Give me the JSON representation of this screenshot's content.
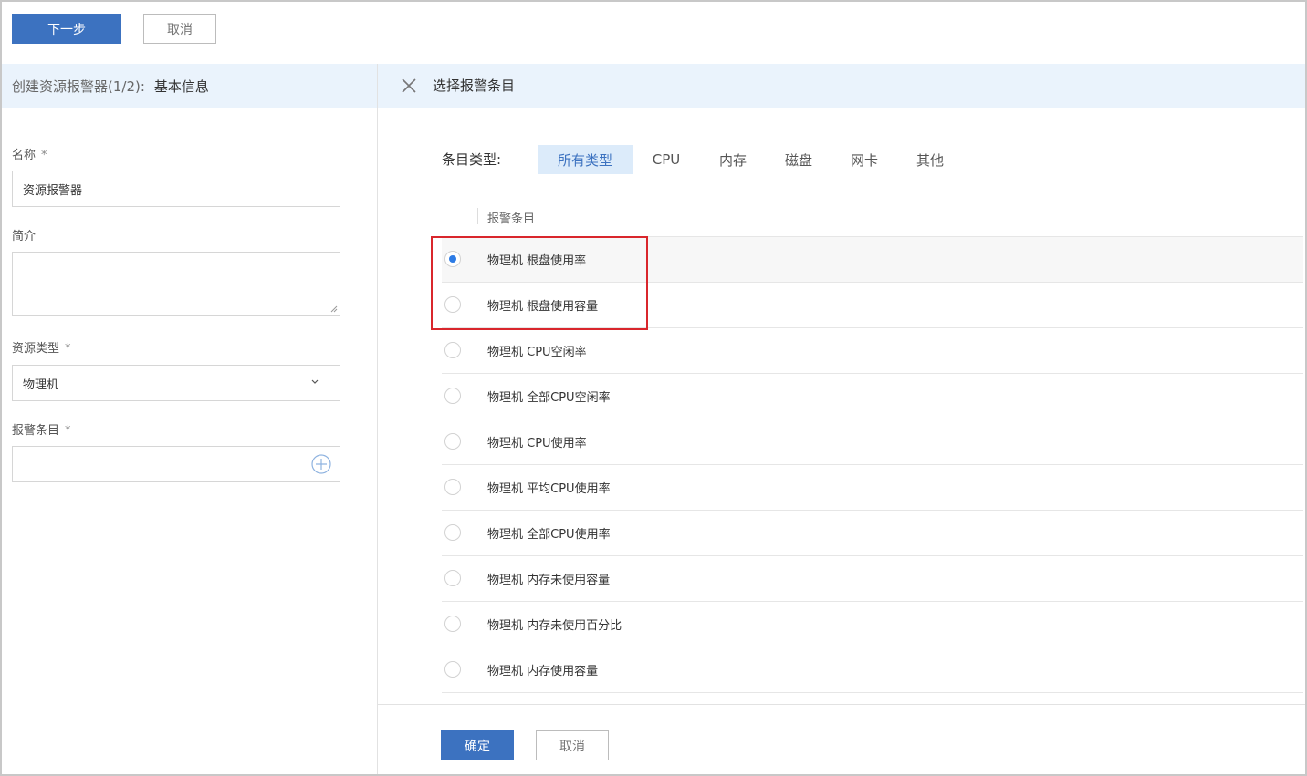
{
  "toolbar": {
    "next_label": "下一步",
    "cancel_label": "取消"
  },
  "left": {
    "header_step": "创建资源报警器(1/2):",
    "header_title": "基本信息",
    "name_label": "名称",
    "required_mark": "*",
    "name_value": "资源报警器",
    "desc_label": "简介",
    "resource_type_label": "资源类型",
    "resource_type_value": "物理机",
    "alarm_item_label": "报警条目"
  },
  "right": {
    "title": "选择报警条目",
    "filter_label": "条目类型:",
    "filters": [
      "所有类型",
      "CPU",
      "内存",
      "磁盘",
      "网卡",
      "其他"
    ],
    "active_filter": "所有类型",
    "column_header": "报警条目",
    "rows": [
      {
        "label": "物理机 根盘使用率",
        "selected": true
      },
      {
        "label": "物理机 根盘使用容量",
        "selected": false
      },
      {
        "label": "物理机 CPU空闲率",
        "selected": false
      },
      {
        "label": "物理机 全部CPU空闲率",
        "selected": false
      },
      {
        "label": "物理机 CPU使用率",
        "selected": false
      },
      {
        "label": "物理机 平均CPU使用率",
        "selected": false
      },
      {
        "label": "物理机 全部CPU使用率",
        "selected": false
      },
      {
        "label": "物理机 内存未使用容量",
        "selected": false
      },
      {
        "label": "物理机 内存未使用百分比",
        "selected": false
      },
      {
        "label": "物理机 内存使用容量",
        "selected": false
      }
    ],
    "confirm_label": "确定",
    "cancel_label": "取消"
  },
  "colors": {
    "primary": "#3c72c0",
    "header_bg": "#eaf3fc",
    "active_tab_bg": "#dcebfa",
    "highlight": "#d9262c",
    "radio_dot": "#2c7be5"
  }
}
